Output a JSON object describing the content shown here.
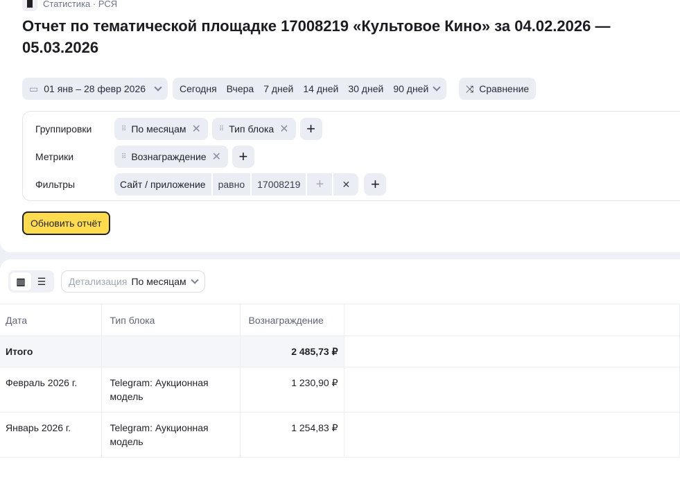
{
  "breadcrumb": "Статистика · РСЯ",
  "title": "Отчет по тематической площадке 17008219 «Культовое Кино» за 04.02.2026 — 05.03.2026",
  "period": "01 янв – 28 февр 2026",
  "presets": [
    "Сегодня",
    "Вчера",
    "7 дней",
    "14 дней",
    "30 дней",
    "90 дней"
  ],
  "compare": "Сравнение",
  "groupings": {
    "label": "Группировки",
    "chips": [
      "По месяцам",
      "Тип блока"
    ]
  },
  "metrics": {
    "label": "Метрики",
    "chips": [
      "Вознаграждение"
    ]
  },
  "filters": {
    "label": "Фильтры",
    "field": "Сайт / приложение",
    "op": "равно",
    "value": "17008219"
  },
  "update": "Обновить отчёт",
  "detail": {
    "label": "Детализация",
    "value": "По месяцам"
  },
  "table": {
    "headers": [
      "Дата",
      "Тип блока",
      "Вознаграждение"
    ],
    "total": {
      "label": "Итого",
      "value": "2 485,73 ₽"
    },
    "rows": [
      {
        "date": "Февраль 2026 г.",
        "type": "Telegram: Аукционная модель",
        "value": "1 230,90 ₽"
      },
      {
        "date": "Январь 2026 г.",
        "type": "Telegram: Аукционная модель",
        "value": "1 254,83 ₽"
      }
    ]
  }
}
